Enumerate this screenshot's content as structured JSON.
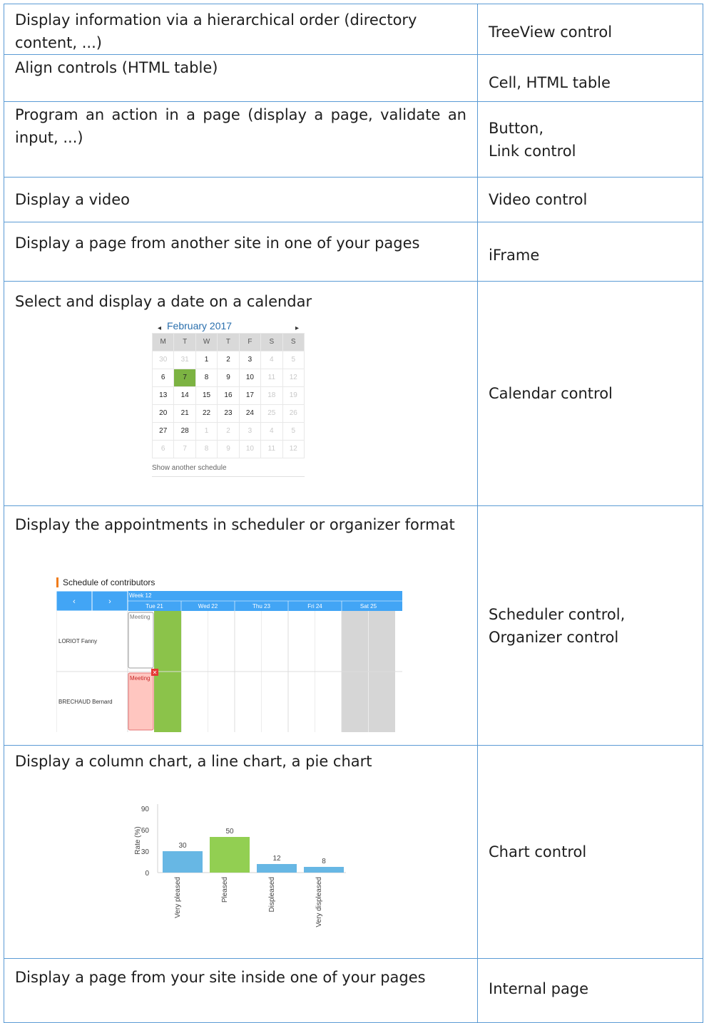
{
  "rows": [
    {
      "need": "Display information via a hierarchical order (directory content, ...)",
      "control": "TreeView control"
    },
    {
      "need": "Align controls (HTML table)",
      "control": "Cell, HTML table"
    },
    {
      "need": "Program an action in a page (display a page, validate an input, ...)",
      "control_line1": "Button,",
      "control_line2": "Link control"
    },
    {
      "need": "Display a video",
      "control": "Video control"
    },
    {
      "need": "Display a page from another site in one of your pages",
      "control": "iFrame"
    },
    {
      "need": "Select and display a date on a calendar",
      "control": "Calendar control"
    },
    {
      "need": "Display the appointments in scheduler or organizer format",
      "control_line1": "Scheduler control,",
      "control_line2": "Organizer control"
    },
    {
      "need": "Display a column chart, a line chart, a pie chart",
      "control": "Chart control"
    },
    {
      "need": "Display a page from your site inside one of your pages",
      "control": "Internal page"
    }
  ],
  "calendar": {
    "prev_glyph": "◂",
    "next_glyph": "▸",
    "month": "February 2017",
    "weekdays": [
      "M",
      "T",
      "W",
      "T",
      "F",
      "S",
      "S"
    ],
    "weeks": [
      [
        "30",
        "31",
        "1",
        "2",
        "3",
        "4",
        "5"
      ],
      [
        "6",
        "7",
        "8",
        "9",
        "10",
        "11",
        "12"
      ],
      [
        "13",
        "14",
        "15",
        "16",
        "17",
        "18",
        "19"
      ],
      [
        "20",
        "21",
        "22",
        "23",
        "24",
        "25",
        "26"
      ],
      [
        "27",
        "28",
        "1",
        "2",
        "3",
        "4",
        "5"
      ],
      [
        "6",
        "7",
        "8",
        "9",
        "10",
        "11",
        "12"
      ]
    ],
    "selected": "7",
    "footer": "Show another schedule"
  },
  "scheduler": {
    "title": "Schedule of contributors",
    "prev": "‹",
    "next": "›",
    "week": "Week 12",
    "days": [
      "Tue 21",
      "Wed 22",
      "Thu 23",
      "Fri 24",
      "Sat 25"
    ],
    "people": [
      "LORIOT Fanny",
      "BRECHAUD Bernard"
    ],
    "event_label": "Meeting",
    "delete_glyph": "✕",
    "colors": {
      "header": "#42a5f5",
      "today": "#8bc34a",
      "weekend": "#d6d6d6",
      "event_alert": "#ffc6c0",
      "accent": "#f07c1a"
    }
  },
  "chart_data": {
    "type": "bar",
    "categories": [
      "Very pleased",
      "Pleased",
      "Displeased",
      "Very displeased"
    ],
    "values": [
      30,
      50,
      12,
      8
    ],
    "ylabel": "Rate (%)",
    "yticks": [
      0,
      30,
      60,
      90
    ],
    "ylim": [
      0,
      90
    ],
    "colors": [
      "#67b7e4",
      "#92cf52",
      "#67b7e4",
      "#67b7e4"
    ]
  }
}
